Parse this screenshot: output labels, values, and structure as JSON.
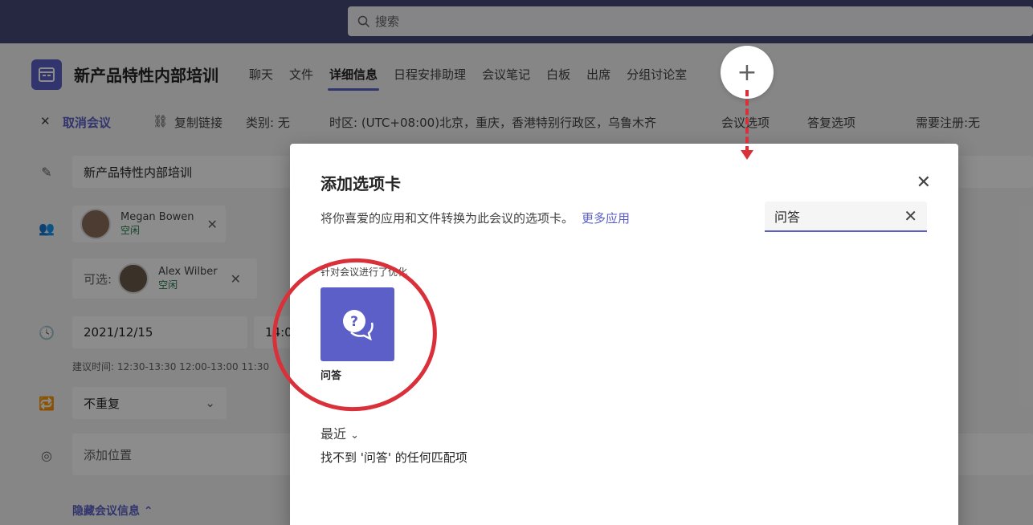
{
  "search": {
    "placeholder": "搜索"
  },
  "meeting": {
    "title": "新产品特性内部培训",
    "tabs": [
      {
        "label": "聊天"
      },
      {
        "label": "文件"
      },
      {
        "label": "详细信息"
      },
      {
        "label": "日程安排助理"
      },
      {
        "label": "会议笔记"
      },
      {
        "label": "白板"
      },
      {
        "label": "出席"
      },
      {
        "label": "分组讨论室"
      }
    ],
    "add_tab_symbol": "+"
  },
  "toolbar": {
    "cancel": "取消会议",
    "copy_link": "复制链接",
    "category": "类别: 无",
    "timezone": "时区: (UTC+08:00)北京，重庆，香港特别行政区，乌鲁木齐",
    "meeting_options": "会议选项",
    "response_options": "答复选项",
    "registration": "需要注册:无"
  },
  "form": {
    "title_value": "新产品特性内部培训",
    "attendees": [
      {
        "name": "Megan Bowen",
        "status": "空闲"
      }
    ],
    "optional_label": "可选:",
    "optional_attendees": [
      {
        "name": "Alex Wilber",
        "status": "空闲"
      }
    ],
    "date": "2021/12/15",
    "time_partial": "14:0",
    "suggested_label": "建议时间:",
    "suggested_times": "12:30-13:30  12:00-13:00  11:30",
    "repeat": "不重复",
    "location_placeholder": "添加位置",
    "hide_info": "隐藏会议信息"
  },
  "dialog": {
    "title": "添加选项卡",
    "description": "将你喜爱的应用和文件转换为此会议的选项卡。",
    "more_apps": "更多应用",
    "search_value": "问答",
    "section_label": "针对会议进行了优化",
    "app": {
      "name": "问答",
      "icon": "qa-chat-icon"
    },
    "recent_label": "最近",
    "no_match": "找不到 '问答' 的任何匹配项"
  },
  "colors": {
    "brand": "#5b5fc7",
    "topbar": "#464775",
    "annotation": "#d9303a"
  }
}
